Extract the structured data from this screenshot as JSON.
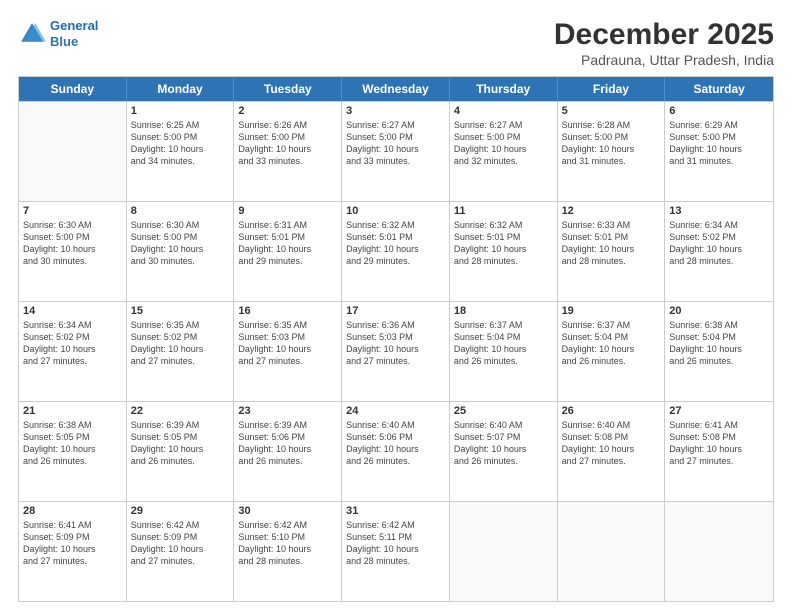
{
  "header": {
    "logo_line1": "General",
    "logo_line2": "Blue",
    "month": "December 2025",
    "location": "Padrauna, Uttar Pradesh, India"
  },
  "days_of_week": [
    "Sunday",
    "Monday",
    "Tuesday",
    "Wednesday",
    "Thursday",
    "Friday",
    "Saturday"
  ],
  "rows": [
    [
      {
        "day": "",
        "lines": []
      },
      {
        "day": "1",
        "lines": [
          "Sunrise: 6:25 AM",
          "Sunset: 5:00 PM",
          "Daylight: 10 hours",
          "and 34 minutes."
        ]
      },
      {
        "day": "2",
        "lines": [
          "Sunrise: 6:26 AM",
          "Sunset: 5:00 PM",
          "Daylight: 10 hours",
          "and 33 minutes."
        ]
      },
      {
        "day": "3",
        "lines": [
          "Sunrise: 6:27 AM",
          "Sunset: 5:00 PM",
          "Daylight: 10 hours",
          "and 33 minutes."
        ]
      },
      {
        "day": "4",
        "lines": [
          "Sunrise: 6:27 AM",
          "Sunset: 5:00 PM",
          "Daylight: 10 hours",
          "and 32 minutes."
        ]
      },
      {
        "day": "5",
        "lines": [
          "Sunrise: 6:28 AM",
          "Sunset: 5:00 PM",
          "Daylight: 10 hours",
          "and 31 minutes."
        ]
      },
      {
        "day": "6",
        "lines": [
          "Sunrise: 6:29 AM",
          "Sunset: 5:00 PM",
          "Daylight: 10 hours",
          "and 31 minutes."
        ]
      }
    ],
    [
      {
        "day": "7",
        "lines": [
          "Sunrise: 6:30 AM",
          "Sunset: 5:00 PM",
          "Daylight: 10 hours",
          "and 30 minutes."
        ]
      },
      {
        "day": "8",
        "lines": [
          "Sunrise: 6:30 AM",
          "Sunset: 5:00 PM",
          "Daylight: 10 hours",
          "and 30 minutes."
        ]
      },
      {
        "day": "9",
        "lines": [
          "Sunrise: 6:31 AM",
          "Sunset: 5:01 PM",
          "Daylight: 10 hours",
          "and 29 minutes."
        ]
      },
      {
        "day": "10",
        "lines": [
          "Sunrise: 6:32 AM",
          "Sunset: 5:01 PM",
          "Daylight: 10 hours",
          "and 29 minutes."
        ]
      },
      {
        "day": "11",
        "lines": [
          "Sunrise: 6:32 AM",
          "Sunset: 5:01 PM",
          "Daylight: 10 hours",
          "and 28 minutes."
        ]
      },
      {
        "day": "12",
        "lines": [
          "Sunrise: 6:33 AM",
          "Sunset: 5:01 PM",
          "Daylight: 10 hours",
          "and 28 minutes."
        ]
      },
      {
        "day": "13",
        "lines": [
          "Sunrise: 6:34 AM",
          "Sunset: 5:02 PM",
          "Daylight: 10 hours",
          "and 28 minutes."
        ]
      }
    ],
    [
      {
        "day": "14",
        "lines": [
          "Sunrise: 6:34 AM",
          "Sunset: 5:02 PM",
          "Daylight: 10 hours",
          "and 27 minutes."
        ]
      },
      {
        "day": "15",
        "lines": [
          "Sunrise: 6:35 AM",
          "Sunset: 5:02 PM",
          "Daylight: 10 hours",
          "and 27 minutes."
        ]
      },
      {
        "day": "16",
        "lines": [
          "Sunrise: 6:35 AM",
          "Sunset: 5:03 PM",
          "Daylight: 10 hours",
          "and 27 minutes."
        ]
      },
      {
        "day": "17",
        "lines": [
          "Sunrise: 6:36 AM",
          "Sunset: 5:03 PM",
          "Daylight: 10 hours",
          "and 27 minutes."
        ]
      },
      {
        "day": "18",
        "lines": [
          "Sunrise: 6:37 AM",
          "Sunset: 5:04 PM",
          "Daylight: 10 hours",
          "and 26 minutes."
        ]
      },
      {
        "day": "19",
        "lines": [
          "Sunrise: 6:37 AM",
          "Sunset: 5:04 PM",
          "Daylight: 10 hours",
          "and 26 minutes."
        ]
      },
      {
        "day": "20",
        "lines": [
          "Sunrise: 6:38 AM",
          "Sunset: 5:04 PM",
          "Daylight: 10 hours",
          "and 26 minutes."
        ]
      }
    ],
    [
      {
        "day": "21",
        "lines": [
          "Sunrise: 6:38 AM",
          "Sunset: 5:05 PM",
          "Daylight: 10 hours",
          "and 26 minutes."
        ]
      },
      {
        "day": "22",
        "lines": [
          "Sunrise: 6:39 AM",
          "Sunset: 5:05 PM",
          "Daylight: 10 hours",
          "and 26 minutes."
        ]
      },
      {
        "day": "23",
        "lines": [
          "Sunrise: 6:39 AM",
          "Sunset: 5:06 PM",
          "Daylight: 10 hours",
          "and 26 minutes."
        ]
      },
      {
        "day": "24",
        "lines": [
          "Sunrise: 6:40 AM",
          "Sunset: 5:06 PM",
          "Daylight: 10 hours",
          "and 26 minutes."
        ]
      },
      {
        "day": "25",
        "lines": [
          "Sunrise: 6:40 AM",
          "Sunset: 5:07 PM",
          "Daylight: 10 hours",
          "and 26 minutes."
        ]
      },
      {
        "day": "26",
        "lines": [
          "Sunrise: 6:40 AM",
          "Sunset: 5:08 PM",
          "Daylight: 10 hours",
          "and 27 minutes."
        ]
      },
      {
        "day": "27",
        "lines": [
          "Sunrise: 6:41 AM",
          "Sunset: 5:08 PM",
          "Daylight: 10 hours",
          "and 27 minutes."
        ]
      }
    ],
    [
      {
        "day": "28",
        "lines": [
          "Sunrise: 6:41 AM",
          "Sunset: 5:09 PM",
          "Daylight: 10 hours",
          "and 27 minutes."
        ]
      },
      {
        "day": "29",
        "lines": [
          "Sunrise: 6:42 AM",
          "Sunset: 5:09 PM",
          "Daylight: 10 hours",
          "and 27 minutes."
        ]
      },
      {
        "day": "30",
        "lines": [
          "Sunrise: 6:42 AM",
          "Sunset: 5:10 PM",
          "Daylight: 10 hours",
          "and 28 minutes."
        ]
      },
      {
        "day": "31",
        "lines": [
          "Sunrise: 6:42 AM",
          "Sunset: 5:11 PM",
          "Daylight: 10 hours",
          "and 28 minutes."
        ]
      },
      {
        "day": "",
        "lines": []
      },
      {
        "day": "",
        "lines": []
      },
      {
        "day": "",
        "lines": []
      }
    ]
  ]
}
